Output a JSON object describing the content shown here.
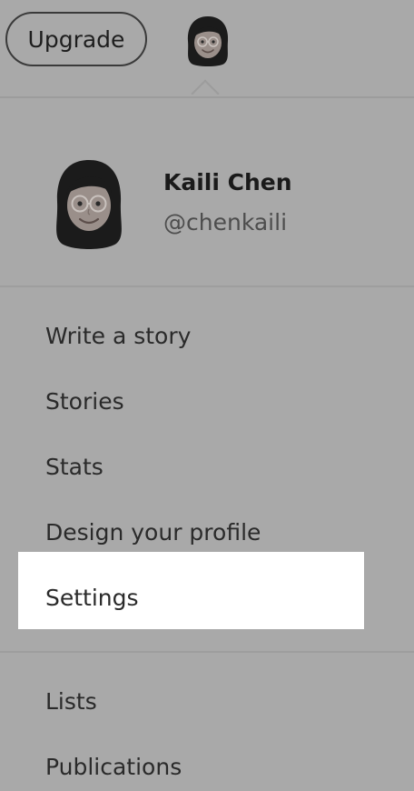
{
  "header": {
    "upgrade_label": "Upgrade"
  },
  "profile": {
    "name": "Kaili Chen",
    "handle": "@chenkaili"
  },
  "menu": {
    "items": [
      {
        "label": "Write a story"
      },
      {
        "label": "Stories"
      },
      {
        "label": "Stats"
      },
      {
        "label": "Design your profile"
      },
      {
        "label": "Settings",
        "highlighted": true
      },
      {
        "label": "Lists"
      },
      {
        "label": "Publications"
      }
    ]
  },
  "icons": {
    "top_avatar": "avatar-icon",
    "profile_avatar": "avatar-icon"
  },
  "colors": {
    "overlay_background": "#a9a9a9",
    "highlight_background": "#ffffff",
    "text_primary": "#1f1f1f",
    "text_secondary": "#4d4d4d"
  }
}
